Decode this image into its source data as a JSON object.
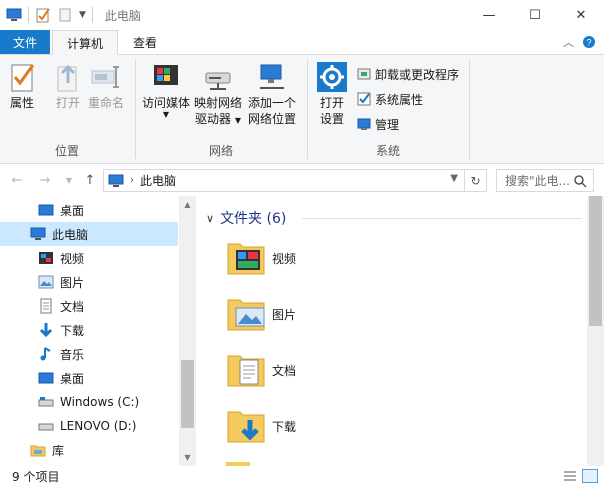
{
  "window": {
    "title": "此电脑",
    "controls": [
      "minimize",
      "maximize",
      "close"
    ]
  },
  "ribbon": {
    "tabs": [
      {
        "label": "文件",
        "active": false,
        "accent": "#1979ca"
      },
      {
        "label": "计算机",
        "active": true
      },
      {
        "label": "查看",
        "active": false
      }
    ],
    "groups": [
      {
        "label": "位置",
        "buttons": [
          {
            "label": "属性",
            "icon": "properties-icon",
            "enabled": true
          },
          {
            "label": "打开",
            "icon": "open-icon",
            "enabled": false
          },
          {
            "label": "重命名",
            "icon": "rename-icon",
            "enabled": false
          }
        ]
      },
      {
        "label": "网络",
        "buttons": [
          {
            "label": "访问媒体",
            "icon": "media-icon",
            "dropdown": true
          },
          {
            "label1": "映射网络",
            "label2": "驱动器",
            "icon": "map-drive-icon",
            "dropdown": true
          },
          {
            "label1": "添加一个",
            "label2": "网络位置",
            "icon": "network-location-icon"
          }
        ]
      },
      {
        "label": "系统",
        "big": {
          "label1": "打开",
          "label2": "设置",
          "icon": "settings-icon"
        },
        "small": [
          {
            "label": "卸载或更改程序",
            "icon": "uninstall-icon"
          },
          {
            "label": "系统属性",
            "icon": "system-properties-icon"
          },
          {
            "label": "管理",
            "icon": "manage-icon"
          }
        ]
      }
    ]
  },
  "navigation": {
    "address": "此电脑",
    "search_placeholder": "搜索\"此电..."
  },
  "nav_pane": {
    "items": [
      {
        "label": "桌面",
        "icon": "desktop-icon",
        "selected": false
      },
      {
        "label": "此电脑",
        "icon": "computer-icon",
        "selected": true
      },
      {
        "label": "视频",
        "icon": "video-icon",
        "selected": false
      },
      {
        "label": "图片",
        "icon": "pictures-icon",
        "selected": false
      },
      {
        "label": "文档",
        "icon": "documents-icon",
        "selected": false
      },
      {
        "label": "下载",
        "icon": "download-icon",
        "selected": false
      },
      {
        "label": "音乐",
        "icon": "music-icon",
        "selected": false
      },
      {
        "label": "桌面",
        "icon": "desktop-icon",
        "selected": false
      },
      {
        "label": "Windows (C:)",
        "icon": "drive-icon",
        "selected": false
      },
      {
        "label": "LENOVO (D:)",
        "icon": "drive-icon",
        "selected": false
      },
      {
        "label": "库",
        "icon": "library-icon",
        "selected": false
      }
    ]
  },
  "content": {
    "group_title": "文件夹 (6)",
    "folders": [
      {
        "label": "视频",
        "icon": "video-folder-icon"
      },
      {
        "label": "图片",
        "icon": "pictures-folder-icon"
      },
      {
        "label": "文档",
        "icon": "documents-folder-icon"
      },
      {
        "label": "下载",
        "icon": "download-folder-icon"
      }
    ]
  },
  "status": {
    "item_count": "9 个项目"
  }
}
